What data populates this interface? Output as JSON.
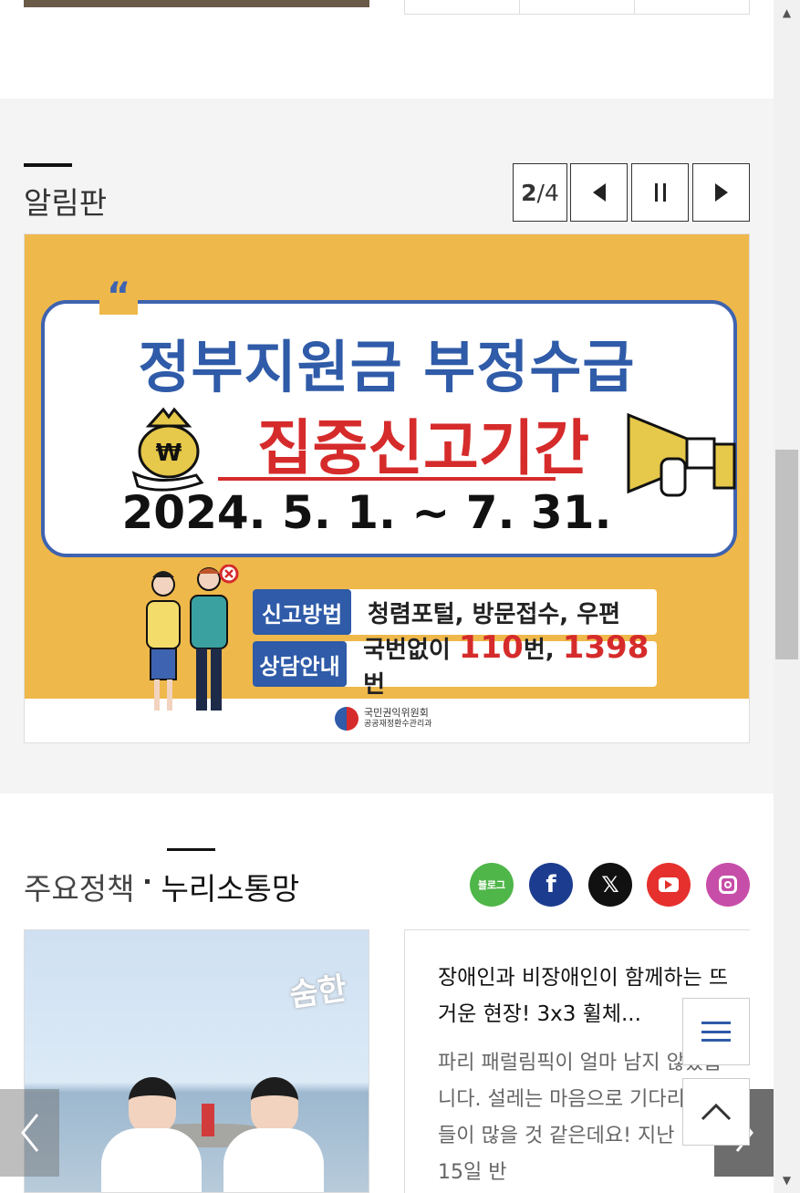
{
  "notice_board": {
    "title": "알림판",
    "pager_current": "2",
    "pager_sep": "/",
    "pager_total": "4",
    "banner": {
      "quote_mark": "“",
      "title_line1": "정부지원금 부정수급",
      "title_line2": "집중신고기간",
      "date": "2024. 5. 1. ~ 7. 31.",
      "report_label": "신고방법",
      "report_text": "청렴포털, 방문접수, 우편",
      "consult_label": "상담안내",
      "consult_prefix": "국번없이",
      "consult_num1": "110",
      "consult_mid": "번,",
      "consult_num2": "1398",
      "consult_suffix": "번",
      "org_name": "국민권익위원회",
      "org_sub": "공공재정환수관리과"
    }
  },
  "policy": {
    "tab_main": "주요정책",
    "tab_nuri": "누리소통망",
    "sns": {
      "blog": "블로그",
      "facebook": "f",
      "x": "𝕏"
    },
    "thumb_logo": "숨한",
    "news_title": "장애인과 비장애인이 함께하는 뜨거운 현장! 3x3 휠체...",
    "news_desc": "파리 패럴림픽이 얼마 남지 않았습니다. 설레는 마음으로 기다리는 분들이 많을 것 같은데요! 지난 6월 15일 반"
  },
  "colors": {
    "accent_blue": "#2f5ba8",
    "accent_red": "#d62b2b",
    "banner_bg": "#efb84b"
  }
}
